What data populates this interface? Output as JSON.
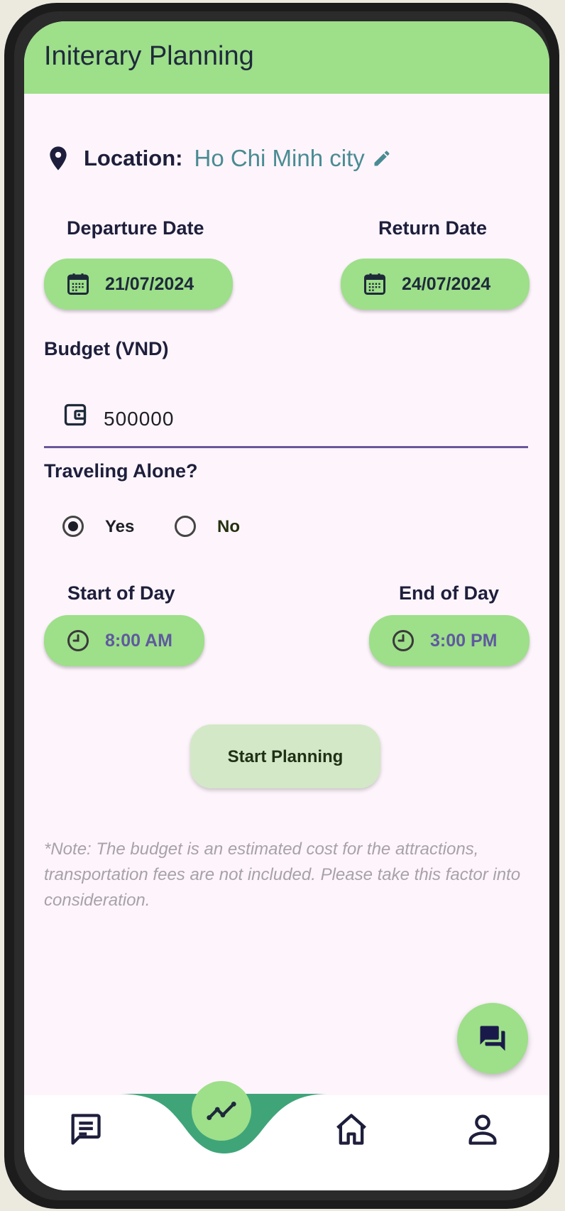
{
  "appbar": {
    "title": "Initerary Planning"
  },
  "location": {
    "label": "Location:",
    "value": "Ho Chi Minh city"
  },
  "dates": {
    "departure_label": "Departure Date",
    "departure_value": "21/07/2024",
    "return_label": "Return Date",
    "return_value": "24/07/2024"
  },
  "budget": {
    "label": "Budget (VND)",
    "value": "500000"
  },
  "traveling_alone": {
    "label": "Traveling Alone?",
    "options": [
      "Yes",
      "No"
    ],
    "selected": "Yes"
  },
  "day_times": {
    "start_label": "Start of Day",
    "start_value": "8:00 AM",
    "end_label": "End of Day",
    "end_value": "3:00 PM"
  },
  "start_button": {
    "label": "Start Planning"
  },
  "note": "*Note: The budget is an estimated cost for the attractions, transportation fees are not included. Please take this factor into consideration.",
  "icons": {
    "location": "map-pin-icon",
    "edit": "pencil-icon",
    "calendar": "calendar-icon",
    "wallet": "wallet-icon",
    "clock": "clock-icon",
    "fab": "chat-bubbles-icon",
    "nav": [
      "chat-icon",
      "trend-chart-icon",
      "home-icon",
      "person-icon"
    ]
  },
  "colors": {
    "accent_green": "#9EDF8A",
    "nav_curve_green": "#3FA579",
    "location_value": "#4A8B93",
    "time_text": "#5E5A9E",
    "input_underline": "#6B559B"
  }
}
